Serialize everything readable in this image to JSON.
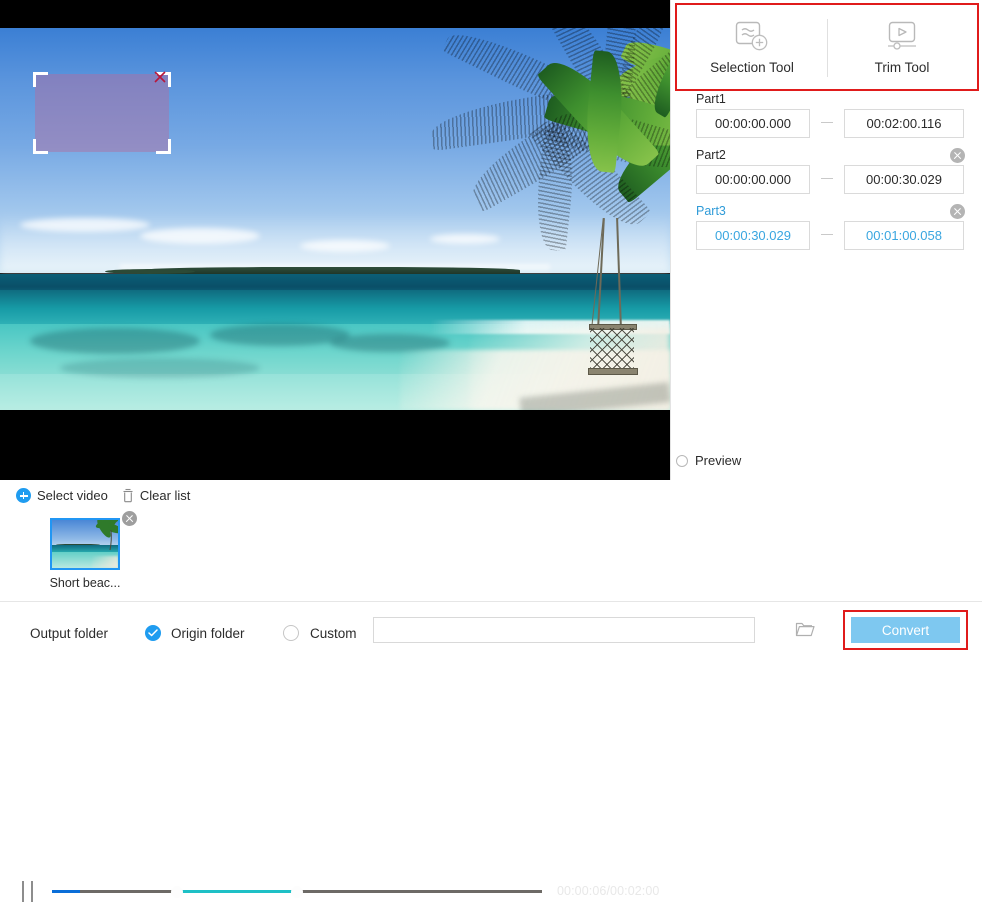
{
  "tools": {
    "selection_tool": {
      "label": "Selection Tool",
      "icon": "selection-tool-icon"
    },
    "trim_tool": {
      "label": "Trim Tool",
      "icon": "trim-tool-icon"
    },
    "highlight_color": "#e01b1b"
  },
  "parts": [
    {
      "title": "Part1",
      "start": "00:00:00.000",
      "end": "00:02:00.116",
      "removable": false,
      "active": false
    },
    {
      "title": "Part2",
      "start": "00:00:00.000",
      "end": "00:00:30.029",
      "removable": true,
      "active": false
    },
    {
      "title": "Part3",
      "start": "00:00:30.029",
      "end": "00:01:00.058",
      "removable": true,
      "active": true
    }
  ],
  "separator": "—",
  "preview": {
    "label": "Preview",
    "checked": false
  },
  "player": {
    "state_icon": "pause-icon",
    "time_display": "00:00:06/00:02:00",
    "current_time": "00:00:06",
    "total_time": "00:02:00",
    "progress_percent": 5.7,
    "range_start_percent": 25.5,
    "range_end_percent": 50.0,
    "progress_color": "#0a6ed8",
    "range_color": "#1ec0c6"
  },
  "selection_overlay": {
    "close_icon": "close-x-icon",
    "fill_color": "#af6ea0"
  },
  "file_list": {
    "select_video": {
      "label": "Select video",
      "icon": "plus-circle-icon"
    },
    "clear_list": {
      "label": "Clear list",
      "icon": "trash-icon"
    },
    "items": [
      {
        "name": "Short beac...",
        "selected": true,
        "close_icon": "close-circle-icon"
      }
    ]
  },
  "output": {
    "label": "Output folder",
    "origin_option": {
      "label": "Origin folder",
      "selected": true
    },
    "custom_option": {
      "label": "Custom",
      "selected": false
    },
    "custom_path": "",
    "custom_path_placeholder": "",
    "browse_icon": "folder-icon",
    "convert_button": {
      "label": "Convert",
      "color": "#7ec8f0"
    },
    "accent_color": "#1f9cf0"
  }
}
